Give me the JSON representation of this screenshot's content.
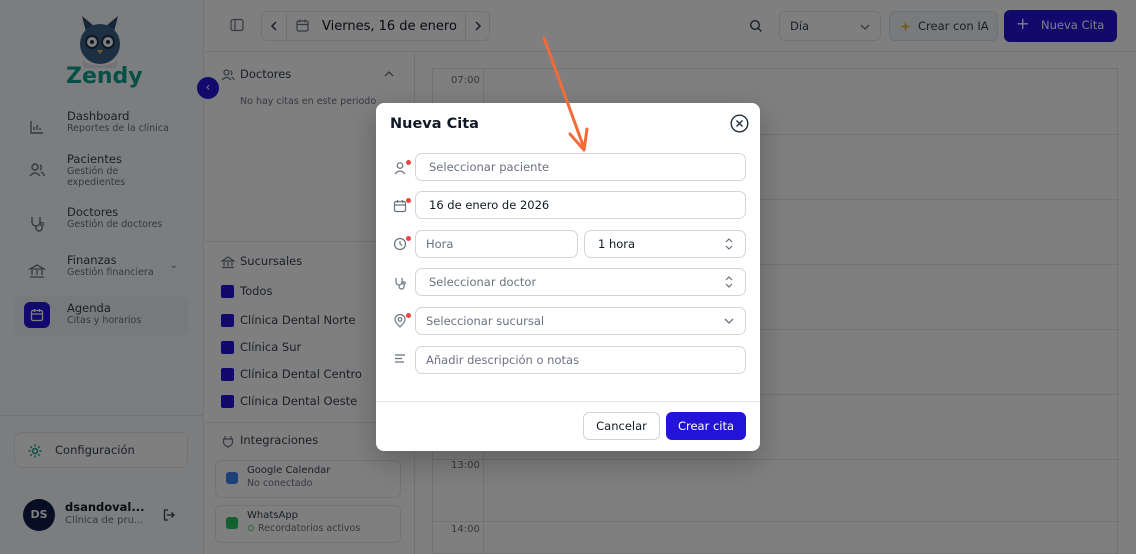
{
  "brand": {
    "name": "Zendy"
  },
  "sidebar": {
    "items": [
      {
        "label": "Dashboard",
        "sub": "Reportes de la clínica",
        "icon": "chart-icon"
      },
      {
        "label": "Pacientes",
        "sub": "Gestión de expedientes",
        "icon": "users-icon"
      },
      {
        "label": "Doctores",
        "sub": "Gestión de doctores",
        "icon": "stethoscope-icon"
      },
      {
        "label": "Finanzas",
        "sub": "Gestión financiera",
        "icon": "bank-icon"
      },
      {
        "label": "Agenda",
        "sub": "Citas y horarios",
        "icon": "calendar-icon",
        "active": true
      }
    ],
    "config_label": "Configuración",
    "user": {
      "initials": "DS",
      "name": "dsandoval...",
      "role": "Clínica de pru..."
    }
  },
  "topbar": {
    "date_label": "Viernes, 16 de enero",
    "view_label": "Día",
    "ai_label": "Crear con IA",
    "new_label": "Nueva Cita"
  },
  "panel": {
    "doctors_title": "Doctores",
    "doctors_empty": "No hay citas en este periodo",
    "branches_title": "Sucursales",
    "branches": [
      "Todos",
      "Clínica Dental Norte",
      "Clínica Sur",
      "Clínica Dental Centro",
      "Clínica Dental Oeste"
    ],
    "integrations_title": "Integraciones",
    "integrations": [
      {
        "name": "Google Calendar",
        "status": "No conectado"
      },
      {
        "name": "WhatsApp",
        "status": "Recordatorios activos"
      }
    ]
  },
  "calendar": {
    "times": [
      "07:00",
      "13:00",
      "14:00"
    ]
  },
  "modal": {
    "title": "Nueva Cita",
    "patient_placeholder": "Seleccionar paciente",
    "date_value": "16 de enero de 2026",
    "time_placeholder": "Hora",
    "duration_value": "1 hora",
    "doctor_placeholder": "Seleccionar doctor",
    "branch_placeholder": "Seleccionar sucursal",
    "notes_placeholder": "Añadir descripción o notas",
    "cancel_label": "Cancelar",
    "create_label": "Crear cita"
  },
  "colors": {
    "primary": "#2313d9",
    "brand_teal": "#0e9f8f",
    "required": "#ef4444",
    "annotation_arrow": "#f26b3a"
  }
}
